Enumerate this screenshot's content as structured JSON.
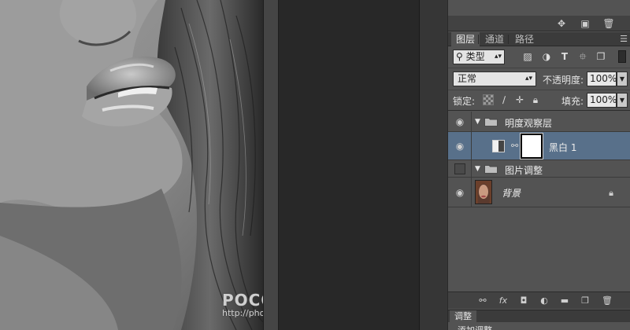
{
  "canvas": {
    "watermark_brand": "POCO 摄影专题",
    "watermark_url": "http://photo.poco.cn/"
  },
  "panel_toolbar_top": {
    "icons": [
      "new-adjustment-icon",
      "camera-icon",
      "trash-icon"
    ]
  },
  "tabs": [
    {
      "label": "图层",
      "active": true
    },
    {
      "label": "通道",
      "active": false
    },
    {
      "label": "路径",
      "active": false
    }
  ],
  "panel_menu_glyph": "☰",
  "filter": {
    "kind_label": "类型",
    "search_glyph": "⚲",
    "icons": [
      "image-filter-icon",
      "adjustment-filter-icon",
      "type-filter-icon",
      "shape-filter-icon",
      "smart-object-filter-icon"
    ]
  },
  "blend": {
    "mode": "正常",
    "opacity_label": "不透明度:",
    "opacity_value": "100%"
  },
  "lock": {
    "label": "锁定:",
    "fill_label": "填充:",
    "fill_value": "100%"
  },
  "layers": [
    {
      "name": "明度观察层",
      "kind": "group",
      "visible": true,
      "expanded": true
    },
    {
      "name": "黑白 1",
      "kind": "adjustment",
      "visible": true,
      "selected": true
    },
    {
      "name": "图片调整",
      "kind": "group",
      "visible": false,
      "expanded": true
    },
    {
      "name": "背景",
      "kind": "background",
      "visible": true,
      "locked": true
    }
  ],
  "bottom_bar": {
    "fx_label": "fx",
    "icons": [
      "link-layers-icon",
      "fx-icon",
      "add-mask-icon",
      "new-fill-adjustment-icon",
      "new-group-icon",
      "new-layer-icon",
      "delete-layer-icon"
    ]
  },
  "adjustments_panel": {
    "tab_label": "调整",
    "subtitle": "添加调整"
  },
  "colors": {
    "panel_bg": "#535353",
    "selected_row": "#58708a",
    "dark_area": "#282828"
  }
}
